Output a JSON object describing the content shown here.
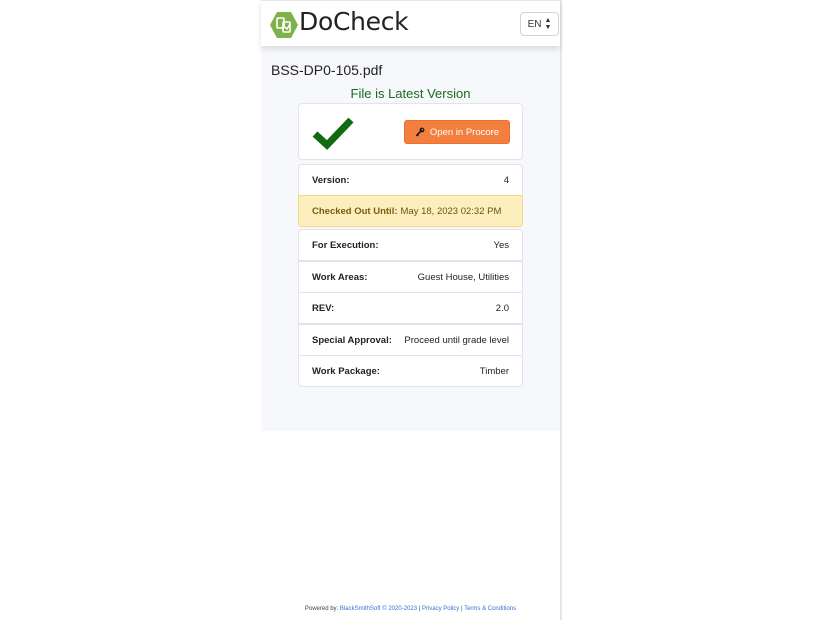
{
  "header": {
    "brand": "DoCheck",
    "language": "EN"
  },
  "file": {
    "name": "BSS-DP0-105.pdf",
    "status": "File is Latest Version",
    "open_button": "Open in Procore"
  },
  "details": {
    "version": {
      "label": "Version:",
      "value": "4"
    },
    "checked_out": {
      "label": "Checked Out Until:",
      "value": "May 18, 2023 02:32 PM"
    },
    "for_execution": {
      "label": "For Execution:",
      "value": "Yes"
    },
    "work_areas": {
      "label": "Work Areas:",
      "value": "Guest House, Utilities"
    },
    "rev": {
      "label": "REV:",
      "value": "2.0"
    },
    "special_approval": {
      "label": "Special Approval:",
      "value": "Proceed until grade level"
    },
    "work_package": {
      "label": "Work Package:",
      "value": "Timber"
    }
  },
  "footer": {
    "powered_by": "Powered by:",
    "company_link": "BlackSmithSoft © 2020-2023",
    "sep1": "|",
    "privacy_link": "Privacy Policy",
    "sep2": "|",
    "terms_link": "Terms & Conditions"
  },
  "colors": {
    "status_green": "#1a6b1a",
    "checkmark_green": "#0f6a12",
    "procore_orange": "#f47e3e",
    "highlight_bg": "#fdefbd",
    "logo_green": "#7fb24a"
  },
  "icons": {
    "logo": "docheck-logo-icon",
    "lang_caret": "sort-caret-icon",
    "check": "checkmark-icon",
    "key": "key-icon"
  }
}
